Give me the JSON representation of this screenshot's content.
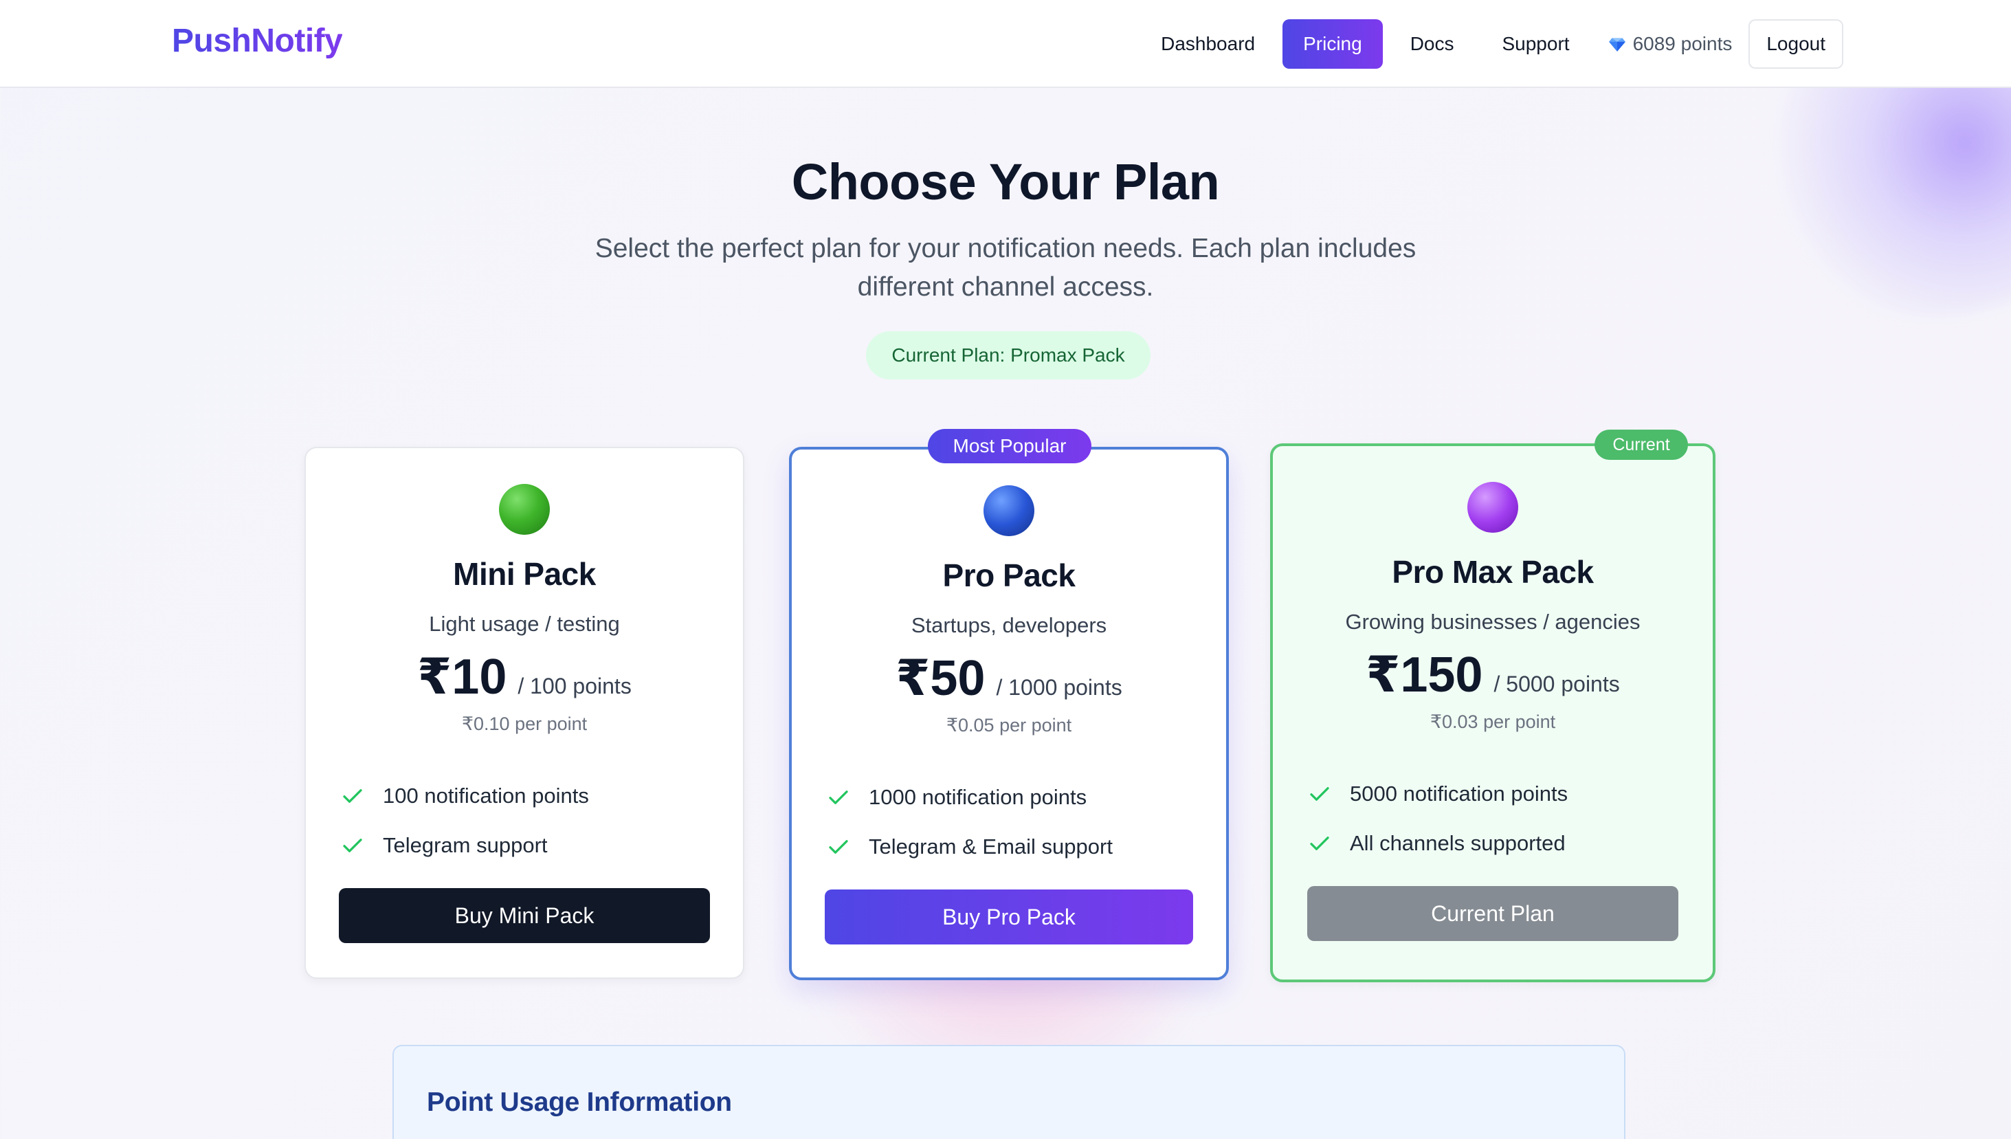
{
  "header": {
    "logo": "PushNotify",
    "nav": [
      {
        "label": "Dashboard"
      },
      {
        "label": "Pricing",
        "active": true
      },
      {
        "label": "Docs"
      },
      {
        "label": "Support"
      }
    ],
    "points_icon": "gem-icon",
    "points_label": "6089 points",
    "logout_label": "Logout"
  },
  "hero": {
    "title": "Choose Your Plan",
    "subtitle": "Select the perfect plan for your notification needs. Each plan includes different channel access.",
    "current_plan": "Current Plan: Promax Pack"
  },
  "plans": [
    {
      "name": "Mini Pack",
      "description": "Light usage / testing",
      "price": "₹10",
      "per": "/ 100 points",
      "unit_price": "₹0.10 per point",
      "features": [
        "100 notification points",
        "Telegram support"
      ],
      "cta": "Buy Mini Pack",
      "orb_color": "#3fb52b"
    },
    {
      "name": "Pro Pack",
      "badge": "Most Popular",
      "description": "Startups, developers",
      "price": "₹50",
      "per": "/ 1000 points",
      "unit_price": "₹0.05 per point",
      "features": [
        "1000 notification points",
        "Telegram & Email support"
      ],
      "cta": "Buy Pro Pack",
      "orb_color": "#2856d6"
    },
    {
      "name": "Pro Max Pack",
      "badge": "Current",
      "description": "Growing businesses / agencies",
      "price": "₹150",
      "per": "/ 5000 points",
      "unit_price": "₹0.03 per point",
      "features": [
        "5000 notification points",
        "All channels supported"
      ],
      "cta": "Current Plan",
      "orb_color": "#a23ff0"
    }
  ],
  "info": {
    "title": "Point Usage Information"
  },
  "colors": {
    "accent_start": "#4f46e5",
    "accent_end": "#7c3aed",
    "success": "#22c55e",
    "current_border": "#5cc878"
  }
}
